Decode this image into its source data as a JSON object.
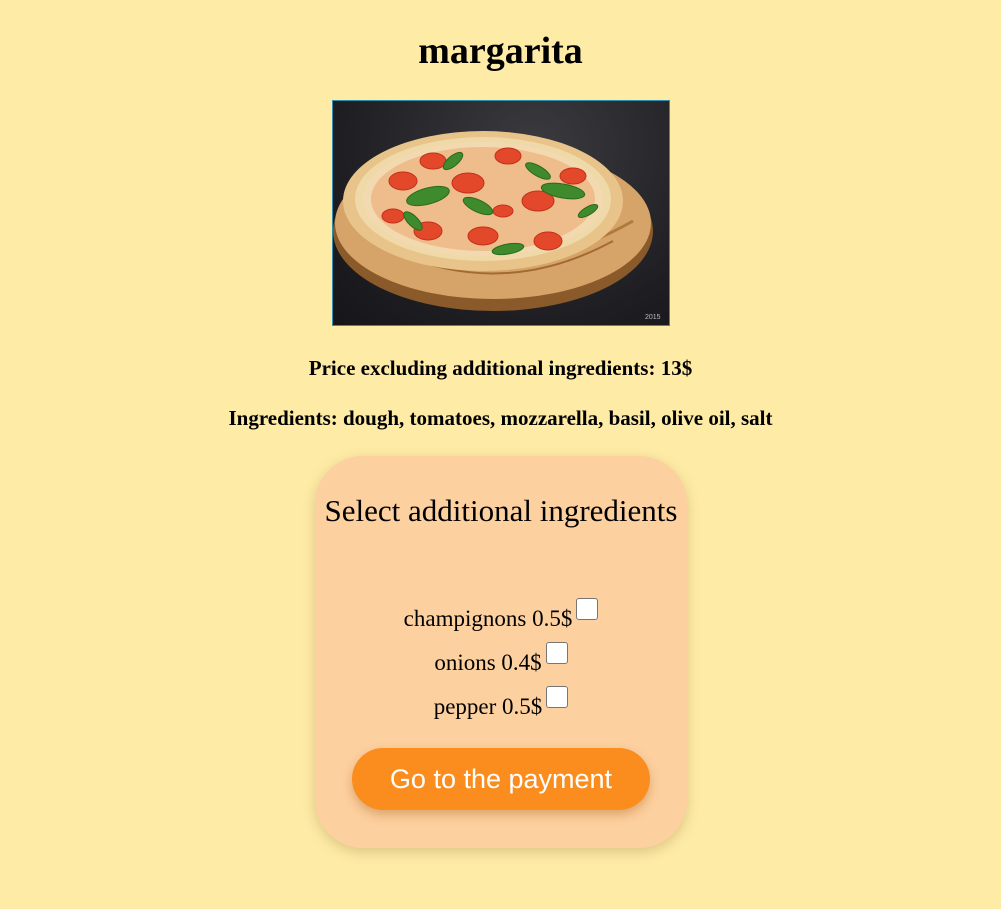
{
  "pizza": {
    "name": "margarita",
    "price_text": "Price excluding additional ingredients: 13$",
    "ingredients_text": "Ingredients: dough, tomatoes, mozzarella, basil, olive oil, salt",
    "photo_watermark": "2015"
  },
  "extras": {
    "heading": "Select additional ingredients",
    "items": [
      {
        "label": "champignons 0.5$",
        "checked": false
      },
      {
        "label": "onions 0.4$",
        "checked": false
      },
      {
        "label": "pepper 0.5$",
        "checked": false
      }
    ]
  },
  "actions": {
    "payment_label": "Go to the payment"
  },
  "colors": {
    "page_background": "#feeba5",
    "card_background": "#fdd09f",
    "button_background": "#fb8d1f",
    "button_text": "#ffffff"
  }
}
